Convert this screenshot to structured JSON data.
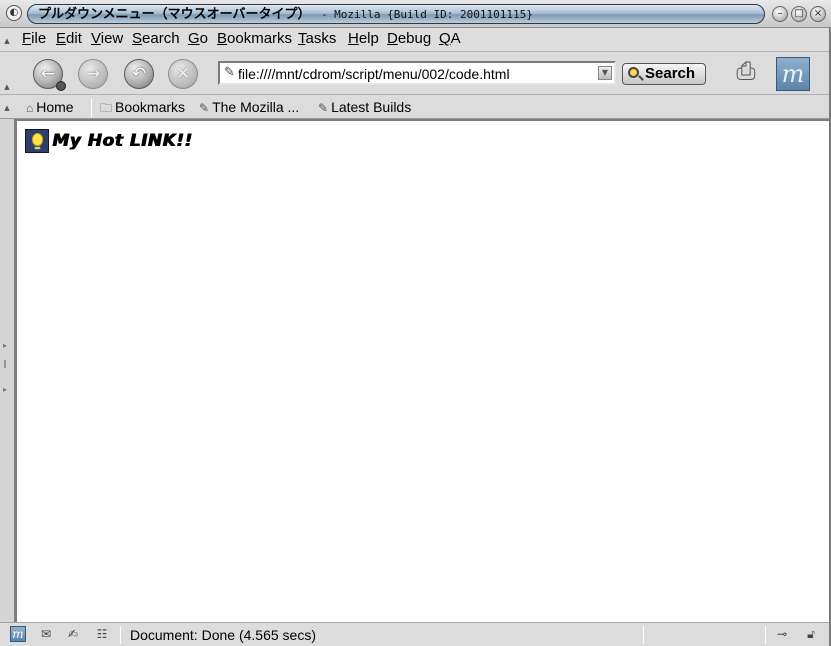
{
  "window": {
    "title_main": "プルダウンメニュー（マウスオーバータイプ）",
    "title_sub": "- Mozilla {Build ID: 2001101115}",
    "app_icon": "mozilla-app-icon",
    "buttons": {
      "minimize": "minimize-icon",
      "maximize": "maximize-icon",
      "close": "close-icon"
    }
  },
  "menubar": {
    "items": [
      {
        "label": "File",
        "underline": "F",
        "rest": "ile"
      },
      {
        "label": "Edit",
        "underline": "E",
        "rest": "dit"
      },
      {
        "label": "View",
        "underline": "V",
        "rest": "iew"
      },
      {
        "label": "Search",
        "underline": "S",
        "rest": "earch"
      },
      {
        "label": "Go",
        "underline": "G",
        "rest": "o"
      },
      {
        "label": "Bookmarks",
        "underline": "B",
        "rest": "ookmarks"
      },
      {
        "label": "Tasks",
        "underline": "T",
        "rest": "asks"
      },
      {
        "label": "Help",
        "underline": "H",
        "rest": "elp"
      },
      {
        "label": "Debug",
        "underline": "D",
        "rest": "ebug"
      },
      {
        "label": "QA",
        "underline": "Q",
        "rest": "A"
      }
    ]
  },
  "navbar": {
    "back": "back-arrow-icon",
    "forward": "forward-arrow-icon",
    "reload": "reload-icon",
    "stop": "stop-icon",
    "url": "file:////mnt/cdrom/script/menu/002/code.html",
    "search_label": "Search",
    "print": "print-icon",
    "logo": "mozilla-logo"
  },
  "personal_toolbar": {
    "home": "Home",
    "bookmarks": "Bookmarks",
    "mozilla": "The Mozilla ...",
    "builds": "Latest Builds"
  },
  "content": {
    "link_text": "My Hot LINK!!",
    "link_icon": "lightbulb-icon"
  },
  "statusbar": {
    "status": "Document: Done (4.565 secs)",
    "icons": [
      "mozilla-icon",
      "mail-icon",
      "composer-icon",
      "address-book-icon"
    ],
    "online": "online-plug-icon",
    "security": "lock-open-icon"
  }
}
